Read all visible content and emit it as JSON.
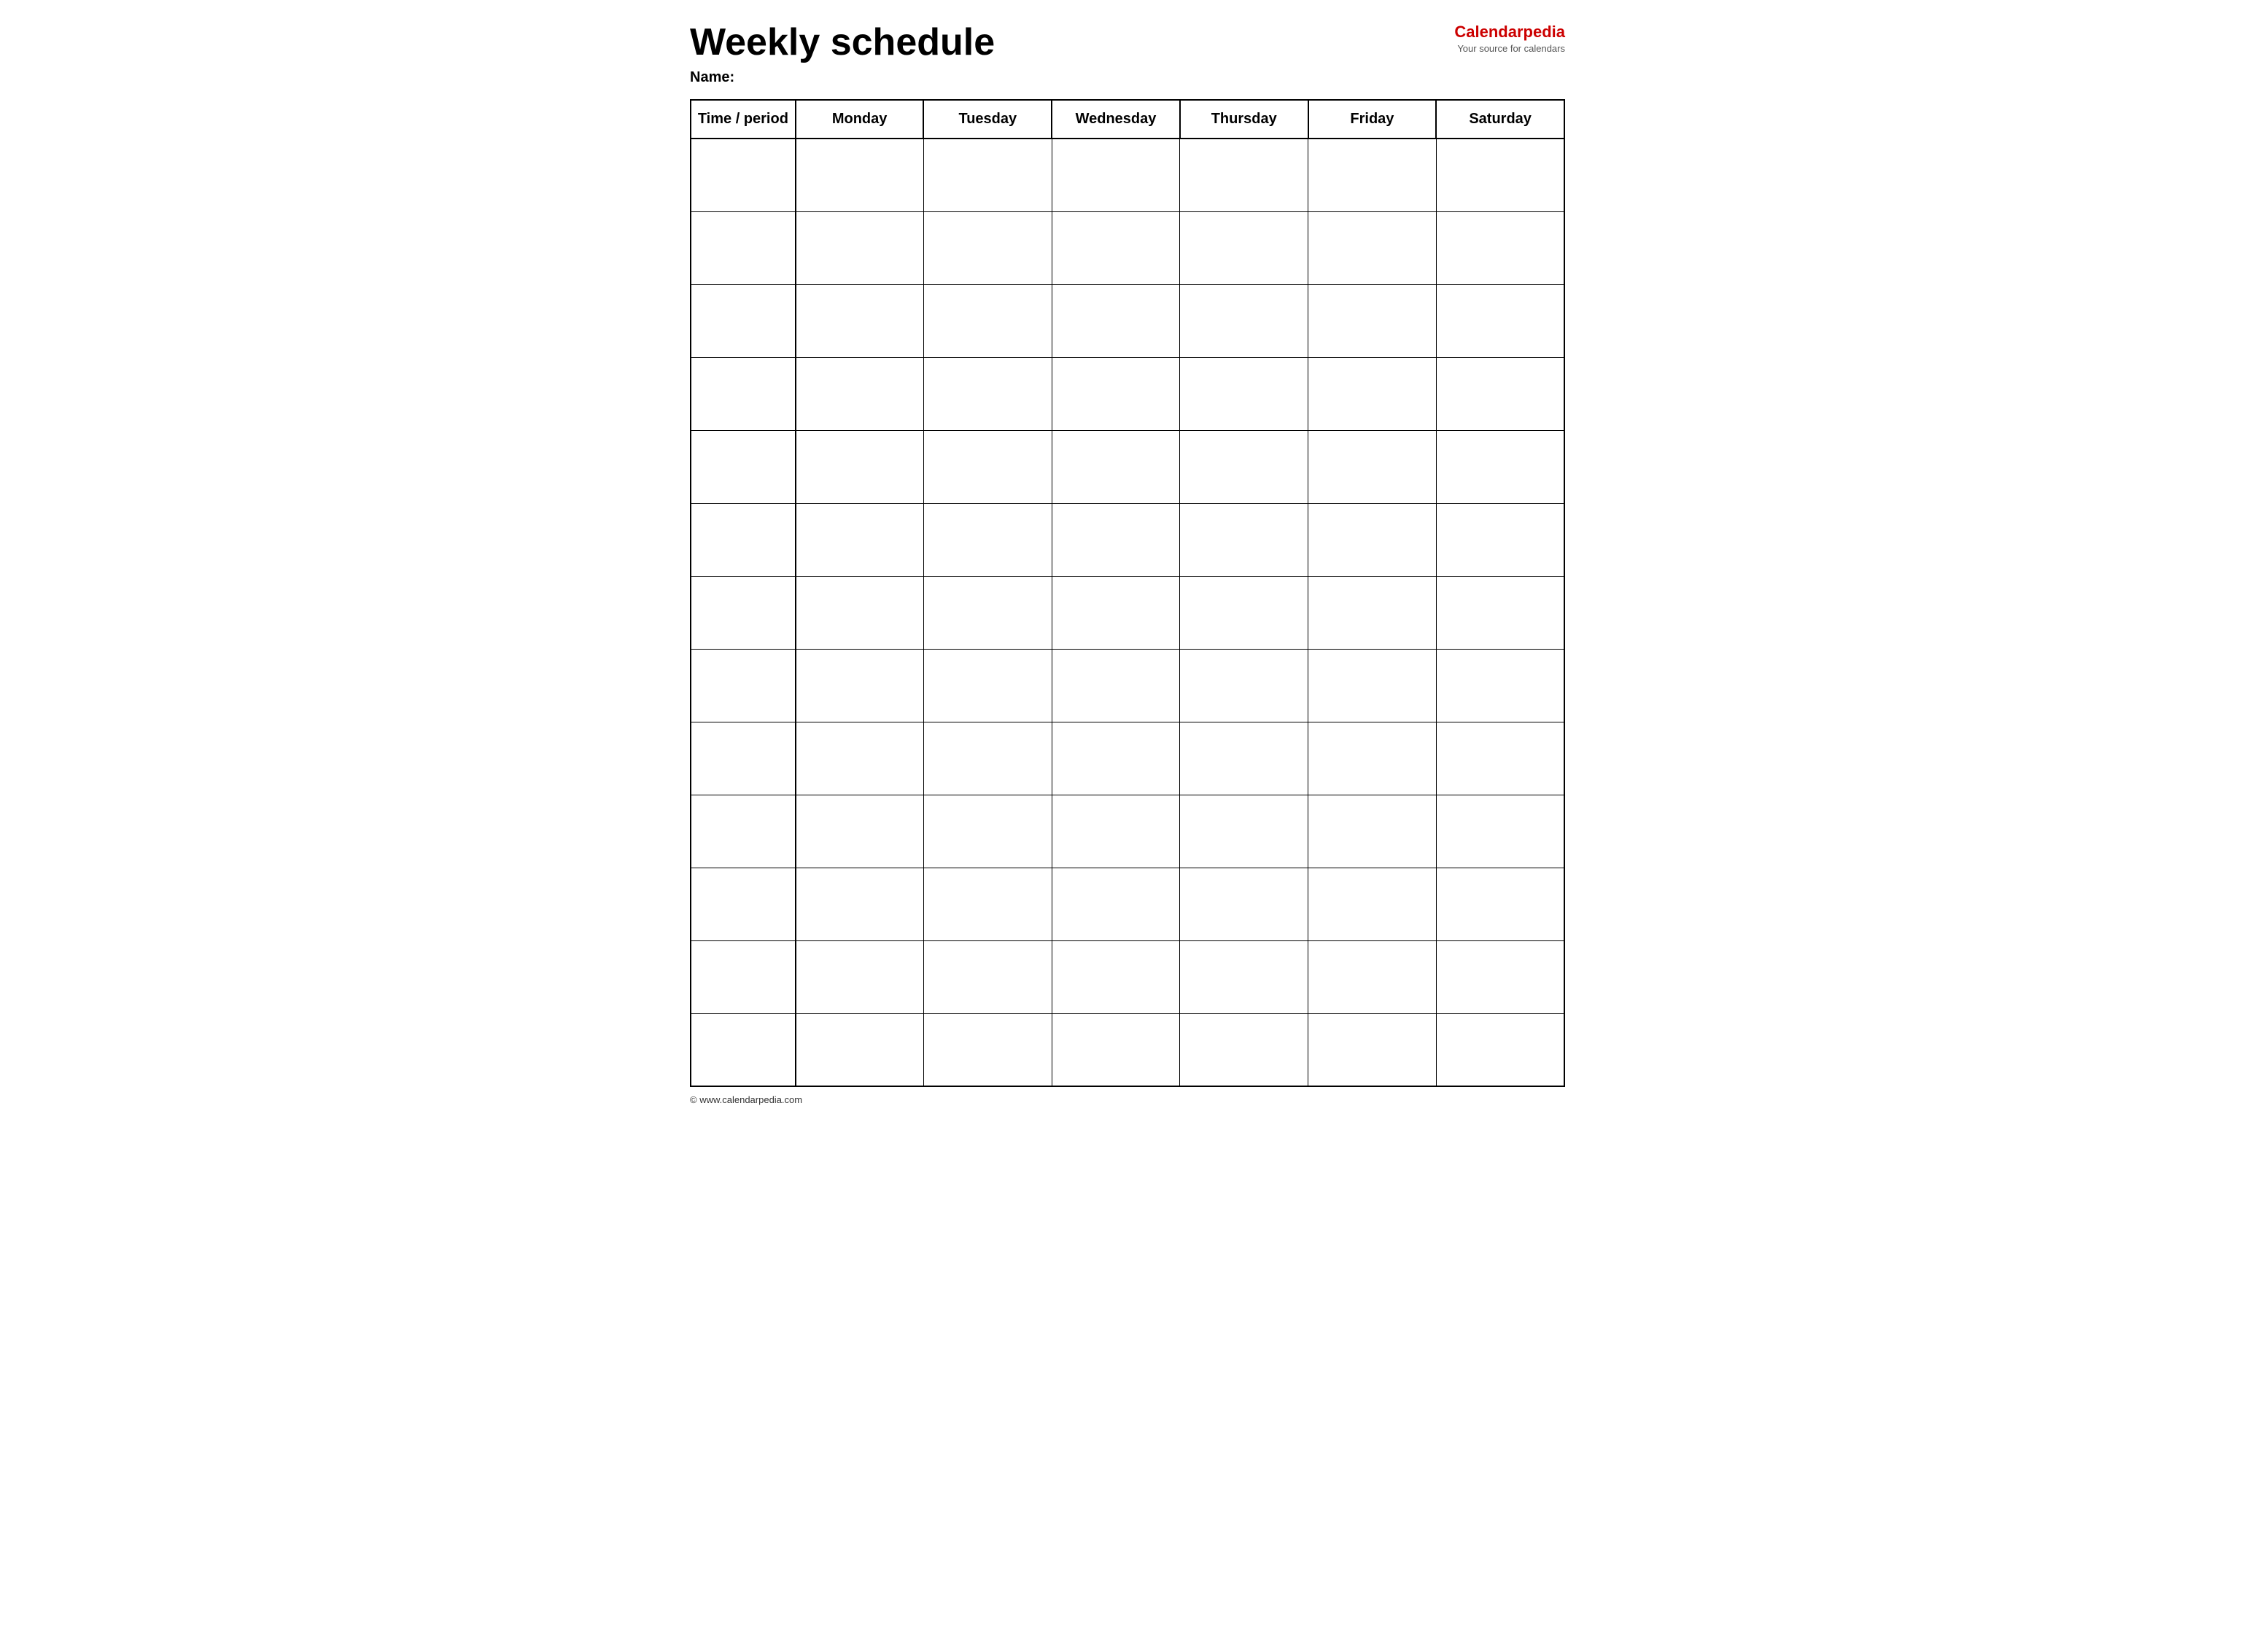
{
  "header": {
    "title": "Weekly schedule",
    "logo": {
      "main_text": "Calendar",
      "main_accent": "pedia",
      "sub_text": "Your source for calendars"
    },
    "name_label": "Name:"
  },
  "table": {
    "columns": [
      {
        "id": "time",
        "label": "Time / period"
      },
      {
        "id": "monday",
        "label": "Monday"
      },
      {
        "id": "tuesday",
        "label": "Tuesday"
      },
      {
        "id": "wednesday",
        "label": "Wednesday"
      },
      {
        "id": "thursday",
        "label": "Thursday"
      },
      {
        "id": "friday",
        "label": "Friday"
      },
      {
        "id": "saturday",
        "label": "Saturday"
      }
    ],
    "row_count": 13
  },
  "footer": {
    "text": "© www.calendarpedia.com"
  }
}
